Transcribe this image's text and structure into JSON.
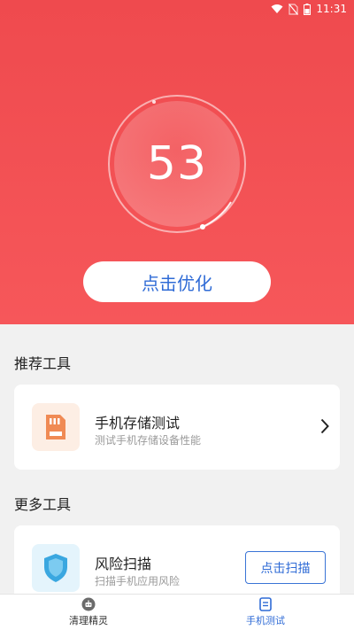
{
  "status_bar": {
    "time": "11:31",
    "icons": [
      "wifi-icon",
      "no-sim-icon",
      "battery-icon"
    ]
  },
  "score": {
    "value": "53"
  },
  "optimize_button": {
    "label": "点击优化"
  },
  "recommended": {
    "title": "推荐工具",
    "items": [
      {
        "title": "手机存储测试",
        "subtitle": "测试手机存储设备性能",
        "icon": "sd-card-icon"
      }
    ]
  },
  "more": {
    "title": "更多工具",
    "items": [
      {
        "title": "风险扫描",
        "subtitle": "扫描手机应用风险",
        "icon": "shield-icon",
        "action_label": "点击扫描"
      }
    ]
  },
  "bottom_nav": {
    "items": [
      {
        "label": "清理精灵",
        "icon": "robot-icon",
        "active": false
      },
      {
        "label": "手机测试",
        "icon": "clipboard-icon",
        "active": true
      }
    ]
  },
  "colors": {
    "hero": "#f05052",
    "accent": "#2f6bd6",
    "active_tab": "#2f6bd6",
    "inactive_tab": "#333333"
  }
}
